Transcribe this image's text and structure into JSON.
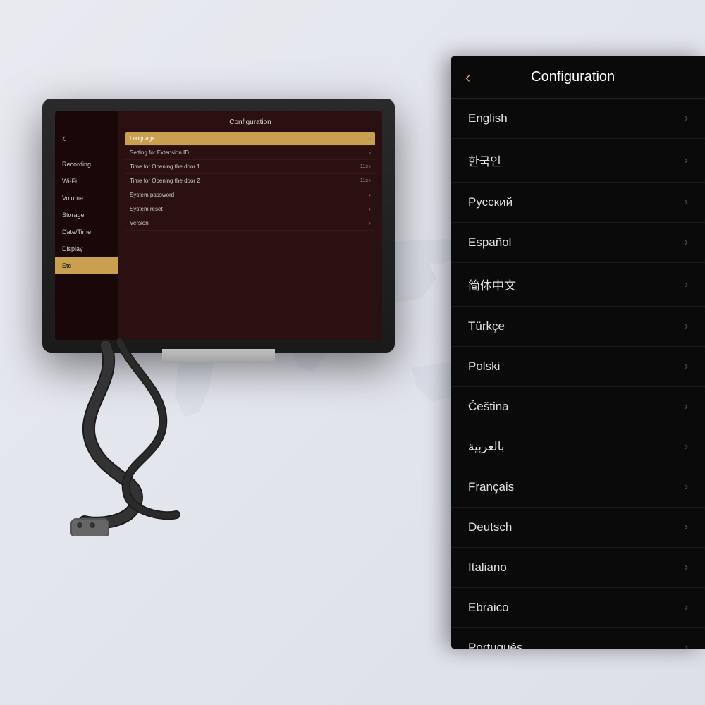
{
  "background": {
    "color": "#e0e2ea"
  },
  "device": {
    "screen": {
      "back_icon": "‹",
      "sidebar_items": [
        {
          "label": "Recording",
          "active": false
        },
        {
          "label": "Wi-Fi",
          "active": false
        },
        {
          "label": "Volume",
          "active": false
        },
        {
          "label": "Storage",
          "active": false
        },
        {
          "label": "Date/Time",
          "active": false
        },
        {
          "label": "Display",
          "active": false
        },
        {
          "label": "Etc",
          "active": true
        }
      ],
      "main_title": "Configuration",
      "main_rows": [
        {
          "label": "Language",
          "value": "",
          "highlighted": true
        },
        {
          "label": "Setting for Extension ID",
          "value": "",
          "highlighted": false
        },
        {
          "label": "Time for Opening the door 1",
          "value": "11s",
          "highlighted": false
        },
        {
          "label": "Time for Opening the door 2",
          "value": "11s",
          "highlighted": false
        },
        {
          "label": "System  password",
          "value": "",
          "highlighted": false
        },
        {
          "label": "System reset",
          "value": "",
          "highlighted": false
        },
        {
          "label": "Version",
          "value": "",
          "highlighted": false
        }
      ]
    }
  },
  "phone_panel": {
    "back_label": "‹",
    "title": "Configuration",
    "languages": [
      {
        "name": "English",
        "id": "english"
      },
      {
        "name": "한국인",
        "id": "korean"
      },
      {
        "name": "Русский",
        "id": "russian"
      },
      {
        "name": "Español",
        "id": "spanish"
      },
      {
        "name": "简体中文",
        "id": "chinese"
      },
      {
        "name": "Türkçe",
        "id": "turkish"
      },
      {
        "name": "Polski",
        "id": "polish"
      },
      {
        "name": "Čeština",
        "id": "czech"
      },
      {
        "name": "بالعربية",
        "id": "arabic"
      },
      {
        "name": "Français",
        "id": "french"
      },
      {
        "name": "Deutsch",
        "id": "german"
      },
      {
        "name": "Italiano",
        "id": "italian"
      },
      {
        "name": "Ebraico",
        "id": "hebrew"
      },
      {
        "name": "Português",
        "id": "portuguese"
      }
    ],
    "chevron": "›"
  }
}
